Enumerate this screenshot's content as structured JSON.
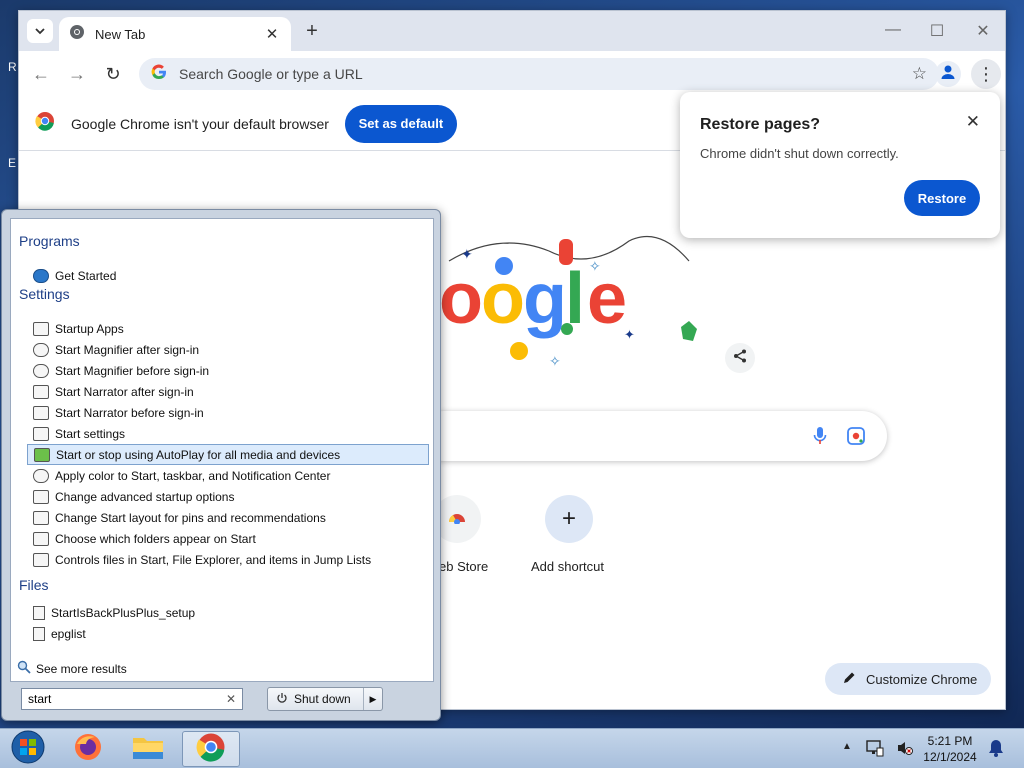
{
  "desktop": {
    "labels": [
      "R",
      "E"
    ]
  },
  "browser": {
    "tab": {
      "title": "New Tab"
    },
    "omnibox": {
      "placeholder": "Search Google or type a URL"
    },
    "infobar": {
      "message": "Google Chrome isn't your default browser",
      "button": "Set as default"
    },
    "restore_popup": {
      "title": "Restore pages?",
      "message": "Chrome didn't shut down correctly.",
      "button": "Restore"
    },
    "ntp": {
      "shortcuts": [
        {
          "label": "Web Store",
          "icon": "chrome-web-store-icon"
        },
        {
          "label": "Add shortcut",
          "icon": "plus-icon"
        }
      ],
      "customize_label": "Customize Chrome"
    }
  },
  "start_menu": {
    "groups": [
      {
        "title": "Programs",
        "items": [
          {
            "label": "Get Started",
            "icon": "get-started-icon"
          }
        ]
      },
      {
        "title": "Settings",
        "items": [
          {
            "label": "Startup Apps",
            "icon": "settings-icon"
          },
          {
            "label": "Start Magnifier after sign-in",
            "icon": "magnifier-icon"
          },
          {
            "label": "Start Magnifier before sign-in",
            "icon": "magnifier-icon"
          },
          {
            "label": "Start Narrator after sign-in",
            "icon": "narrator-icon"
          },
          {
            "label": "Start Narrator before sign-in",
            "icon": "narrator-icon"
          },
          {
            "label": "Start settings",
            "icon": "settings-icon"
          },
          {
            "label": "Start or stop using AutoPlay for all media and devices",
            "icon": "autoplay-icon"
          },
          {
            "label": "Apply color to Start, taskbar, and Notification Center",
            "icon": "color-icon"
          },
          {
            "label": "Change advanced startup options",
            "icon": "recovery-icon"
          },
          {
            "label": "Change Start layout for pins and recommendations",
            "icon": "settings-icon"
          },
          {
            "label": "Choose which folders appear on Start",
            "icon": "settings-icon"
          },
          {
            "label": "Controls files in Start, File Explorer, and items in Jump Lists",
            "icon": "settings-icon"
          }
        ]
      },
      {
        "title": "Files",
        "items": [
          {
            "label": "StartIsBackPlusPlus_setup",
            "icon": "installer-icon"
          },
          {
            "label": "epglist",
            "icon": "document-icon"
          }
        ]
      }
    ],
    "see_more": "See more results",
    "search_value": "start",
    "shutdown_label": "Shut down"
  },
  "taskbar": {
    "apps": [
      "start-orb-icon",
      "firefox-icon",
      "file-explorer-icon",
      "chrome-icon"
    ],
    "time": "5:21 PM",
    "date": "12/1/2024"
  },
  "colors": {
    "accent": "#0b57d0",
    "startmenu_header": "#1e3f87"
  }
}
